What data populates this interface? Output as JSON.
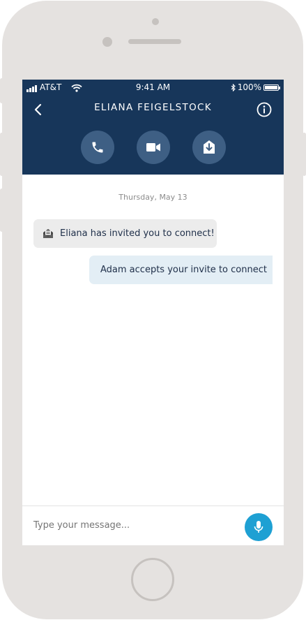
{
  "status_bar": {
    "carrier": "AT&T",
    "time": "9:41 AM",
    "battery": "100%"
  },
  "header": {
    "title": "ELIANA FEIGELSTOCK"
  },
  "conversation": {
    "date": "Thursday, May 13",
    "messages": [
      {
        "direction": "incoming",
        "icon": "envelope-invite-icon",
        "text": "Eliana has invited you to connect!"
      },
      {
        "direction": "outgoing",
        "text": "Adam accepts your invite to connect"
      }
    ]
  },
  "composer": {
    "placeholder": "Type your message..."
  },
  "colors": {
    "header_bg": "#17365a",
    "action_button_bg": "#3e5f84",
    "mic_button_bg": "#1ea0d3",
    "incoming_bubble": "#ececec",
    "outgoing_bubble": "#e3eef5",
    "device_frame": "#e5e2e0"
  }
}
